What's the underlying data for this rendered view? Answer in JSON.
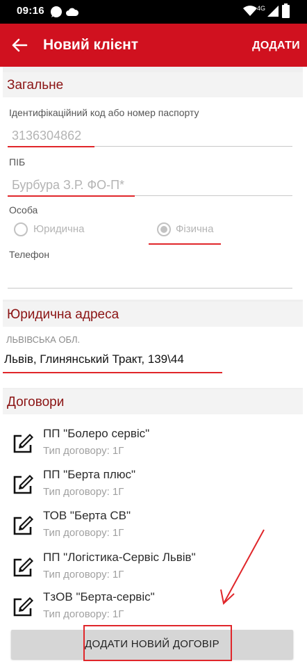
{
  "status_bar": {
    "time": "09:16",
    "network": "4G",
    "icons": [
      "whatsapp-icon",
      "cloud-icon",
      "wifi-icon",
      "signal-icon",
      "battery-icon"
    ]
  },
  "app_bar": {
    "title": "Новий клієнт",
    "action": "ДОДАТИ",
    "color": "#d0111f"
  },
  "general": {
    "header": "Загальне",
    "id_label": "Ідентифікаційний код або номер паспорту",
    "id_value": "3136304862",
    "name_label": "ПІБ",
    "name_value": "Бурбура З.Р. ФО-П*",
    "person_label": "Особа",
    "options": [
      {
        "label": "Юридична",
        "selected": false
      },
      {
        "label": "Фізична",
        "selected": true
      }
    ],
    "phone_label": "Телефон",
    "phone_value": ""
  },
  "legal_address": {
    "header": "Юридична адреса",
    "region": "ЛЬВІВСЬКА ОБЛ.",
    "address": "Львів, Глинянський Тракт, 139\\44"
  },
  "contracts": {
    "header": "Договори",
    "items": [
      {
        "name": "ПП \"Болеро сервіс\"",
        "type": "Тип договору: 1Г"
      },
      {
        "name": "ПП \"Берта плюс\"",
        "type": "Тип договору: 1Г"
      },
      {
        "name": "ТОВ \"Берта СВ\"",
        "type": "Тип договору: 1Г"
      },
      {
        "name": "ПП \"Логістика-Сервіс Львів\"",
        "type": "Тип договору: 1Г"
      },
      {
        "name": "ТзОВ \"Берта-сервіс\"",
        "type": "Тип договору: 1Г"
      }
    ],
    "add_button": "ДОДАТИ НОВИЙ ДОГОВІР"
  },
  "annotation_color": "#e0262a"
}
